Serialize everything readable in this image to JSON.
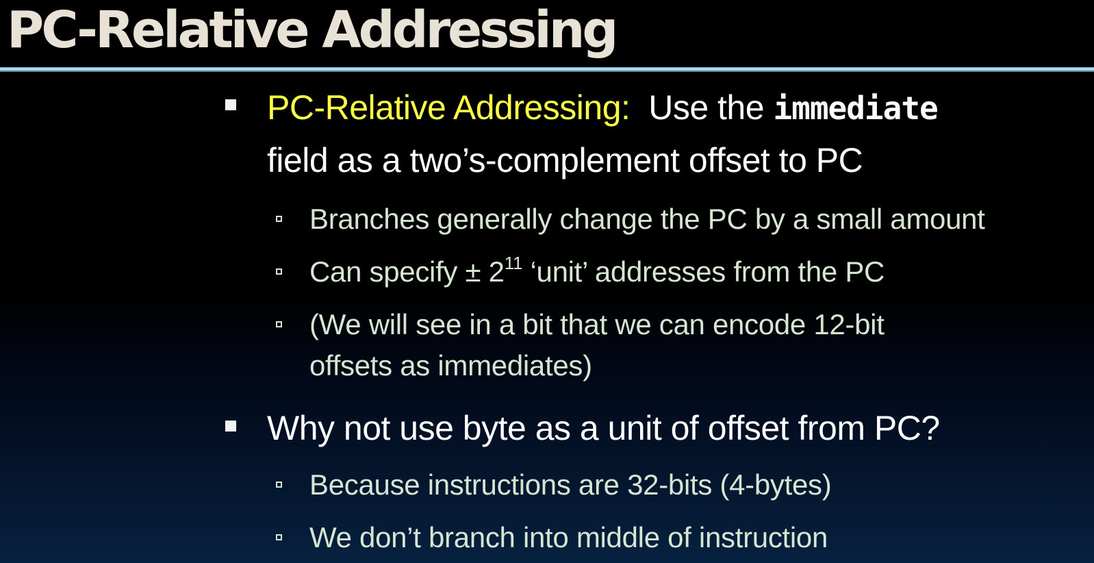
{
  "slide": {
    "title": "PC-Relative Addressing",
    "bullet1": {
      "label": "PC-Relative Addressing:",
      "text_before_code": "Use the",
      "code": "immediate",
      "continuation": "field as a two’s-complement offset to PC",
      "sub_items": [
        "Branches generally change the PC by a small amount",
        "(We will see in a bit that we can encode 12-bit",
        "offsets as immediates)"
      ],
      "item2": {
        "prefix": "Can specify",
        "symbol": "±",
        "base": "2",
        "exponent": "11",
        "suffix": "‘unit’ addresses from the PC"
      }
    },
    "bullet2": {
      "text": "Why not use byte as a unit of offset from PC?",
      "sub_items": [
        "Because instructions are 32-bits (4-bytes)",
        "We don’t branch into middle of instruction"
      ]
    }
  },
  "colors": {
    "title": "#e8e1d6",
    "highlight": "#ffff44",
    "body": "#ffffff",
    "sub_body": "#d6e6d2",
    "rule": "#bfe9f6"
  }
}
